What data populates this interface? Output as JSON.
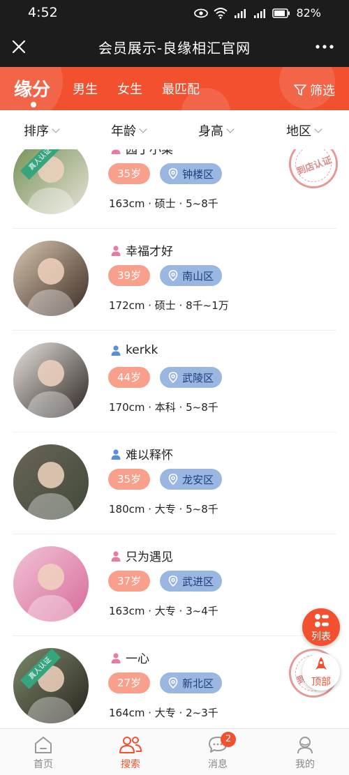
{
  "status_bar": {
    "time": "4:52",
    "battery": "82%",
    "network": "4G"
  },
  "header": {
    "title": "会员展示-良缘相汇官网"
  },
  "tabs": [
    {
      "label": "缘分",
      "active": true
    },
    {
      "label": "男生"
    },
    {
      "label": "女生"
    },
    {
      "label": "最匹配"
    }
  ],
  "filter": {
    "label": "筛选"
  },
  "sort_bar": [
    {
      "label": "排序"
    },
    {
      "label": "年龄"
    },
    {
      "label": "身高"
    },
    {
      "label": "地区"
    }
  ],
  "members": [
    {
      "name": "园丁小菜",
      "gender": "female",
      "age": "35岁",
      "district": "钟楼区",
      "info": "163cm · 硕士 · 5~8千",
      "verified": true,
      "verify_label": "真人认证",
      "stamp": "到店认证",
      "avatar_colors": [
        "#6f8f52",
        "#e9e2d8"
      ]
    },
    {
      "name": "幸福才好",
      "gender": "female",
      "age": "39岁",
      "district": "南山区",
      "info": "172cm · 硕士 · 8千~1万",
      "verified": false,
      "avatar_colors": [
        "#d8c7b0",
        "#3a2a22"
      ]
    },
    {
      "name": "kerkk",
      "gender": "male",
      "age": "44岁",
      "district": "武陵区",
      "info": "170cm · 本科 · 5~8千",
      "verified": false,
      "avatar_colors": [
        "#e8e4de",
        "#2a2320"
      ]
    },
    {
      "name": "难以释怀",
      "gender": "male",
      "age": "35岁",
      "district": "龙安区",
      "info": "180cm · 大专 · 5~8千",
      "verified": false,
      "avatar_colors": [
        "#6b6457",
        "#3f4a3a"
      ]
    },
    {
      "name": "只为遇见",
      "gender": "female",
      "age": "37岁",
      "district": "武进区",
      "info": "163cm · 大专 · 3~4千",
      "verified": false,
      "avatar_colors": [
        "#f1c3d6",
        "#d86b9b"
      ]
    },
    {
      "name": "一心",
      "gender": "female",
      "age": "27岁",
      "district": "新北区",
      "info": "164cm · 大专 · 2~3千",
      "verified": true,
      "verify_label": "真人认证",
      "stamp": "到店认证",
      "avatar_colors": [
        "#7a8a6a",
        "#2a221e"
      ]
    }
  ],
  "fab": {
    "list_label": "列表",
    "top_label": "顶部"
  },
  "bottom_nav": [
    {
      "label": "首页",
      "icon": "home-icon"
    },
    {
      "label": "搜索",
      "icon": "people-icon",
      "active": true
    },
    {
      "label": "消息",
      "icon": "chat-icon",
      "badge": "2"
    },
    {
      "label": "我的",
      "icon": "profile-icon"
    }
  ],
  "colors": {
    "accent": "#f2502f",
    "age_tag": "#f8a08c",
    "area_tag": "#9ab7e2",
    "female": "#e57da0",
    "male": "#5a8fd6"
  }
}
